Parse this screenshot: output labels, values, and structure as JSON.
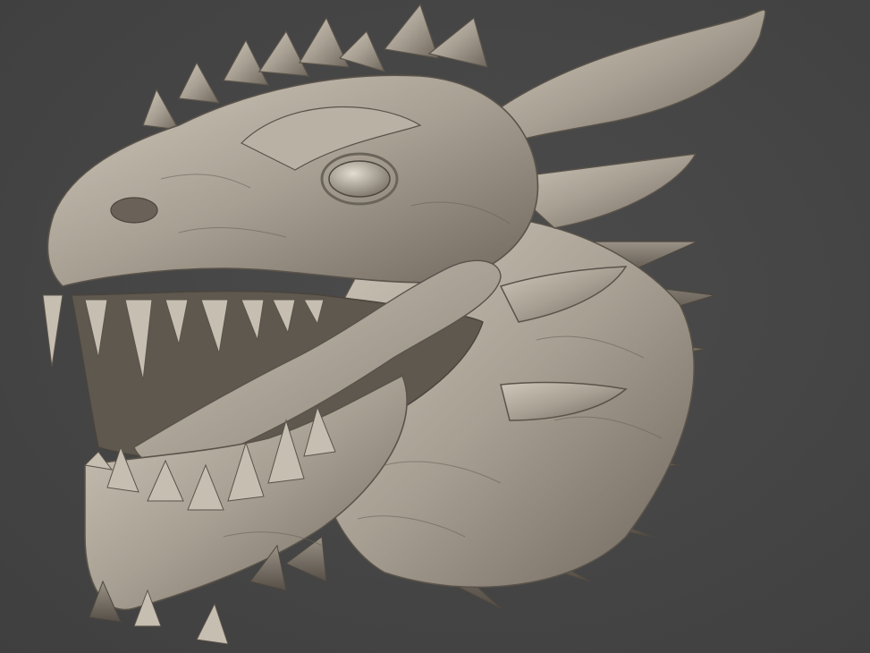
{
  "viewport": {
    "background_color": "#454545",
    "subject": "dragon-head-sculpt",
    "material_color": "#a8a093",
    "material_shadow": "#5e574e",
    "material_highlight": "#d2cbbe"
  }
}
